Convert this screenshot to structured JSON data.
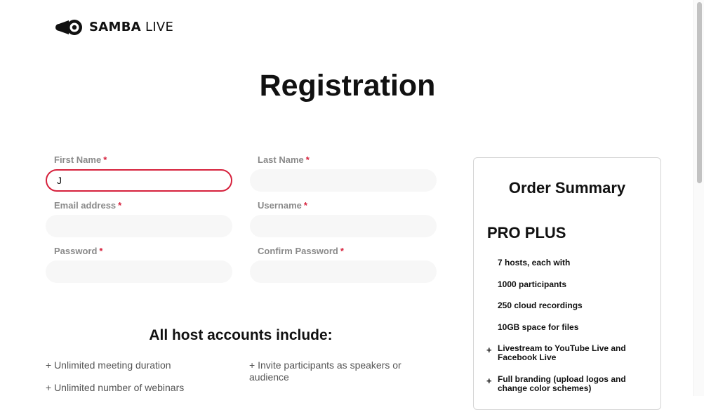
{
  "brand": {
    "name_bold": "SAMBA",
    "name_light": "LIVE"
  },
  "page": {
    "title": "Registration"
  },
  "form": {
    "first_name": {
      "label": "First Name",
      "value": "J"
    },
    "last_name": {
      "label": "Last Name",
      "value": ""
    },
    "email": {
      "label": "Email address",
      "value": ""
    },
    "username": {
      "label": "Username",
      "value": ""
    },
    "password": {
      "label": "Password",
      "value": ""
    },
    "confirm_password": {
      "label": "Confirm Password",
      "value": ""
    },
    "required_marker": "*"
  },
  "features": {
    "title": "All host accounts include:",
    "left": [
      "+ Unlimited meeting duration",
      "+ Unlimited number of webinars"
    ],
    "right": [
      "+ Invite participants as speakers or audience"
    ]
  },
  "order_summary": {
    "title": "Order Summary",
    "plan": "PRO PLUS",
    "items": [
      {
        "prefix": "",
        "text": "7 hosts, each with"
      },
      {
        "prefix": "",
        "text": "1000 participants"
      },
      {
        "prefix": "",
        "text": "250 cloud recordings"
      },
      {
        "prefix": "",
        "text": "10GB space for files"
      },
      {
        "prefix": "+",
        "text": "Livestream to YouTube Live and Facebook Live"
      },
      {
        "prefix": "+",
        "text": "Full branding (upload logos and change color schemes)"
      }
    ]
  },
  "colors": {
    "accent": "#d6213c",
    "input_bg": "#f7f7f7",
    "label": "#8a8a8a"
  }
}
